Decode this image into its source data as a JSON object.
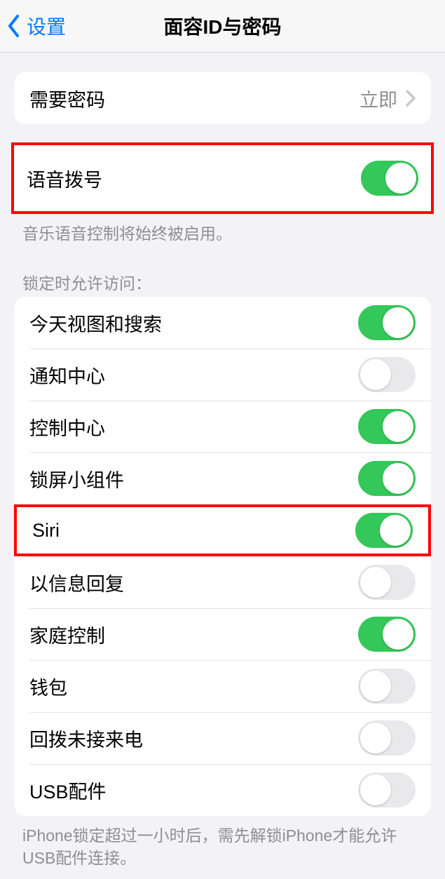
{
  "nav": {
    "back_label": "设置",
    "title": "面容ID与密码"
  },
  "passcode_group": {
    "require_label": "需要密码",
    "require_value": "立即"
  },
  "voice_dial": {
    "label": "语音拨号",
    "on": true,
    "footer": "音乐语音控制将始终被启用。"
  },
  "lock_access": {
    "header": "锁定时允许访问：",
    "items": [
      {
        "label": "今天视图和搜索",
        "on": true,
        "highlight": false
      },
      {
        "label": "通知中心",
        "on": false,
        "highlight": false
      },
      {
        "label": "控制中心",
        "on": true,
        "highlight": false
      },
      {
        "label": "锁屏小组件",
        "on": true,
        "highlight": false
      },
      {
        "label": "Siri",
        "on": true,
        "highlight": true
      },
      {
        "label": "以信息回复",
        "on": false,
        "highlight": false
      },
      {
        "label": "家庭控制",
        "on": true,
        "highlight": false
      },
      {
        "label": "钱包",
        "on": false,
        "highlight": false
      },
      {
        "label": "回拨未接来电",
        "on": false,
        "highlight": false
      },
      {
        "label": "USB配件",
        "on": false,
        "highlight": false
      }
    ],
    "footer": "iPhone锁定超过一小时后，需先解锁iPhone才能允许USB配件连接。"
  }
}
